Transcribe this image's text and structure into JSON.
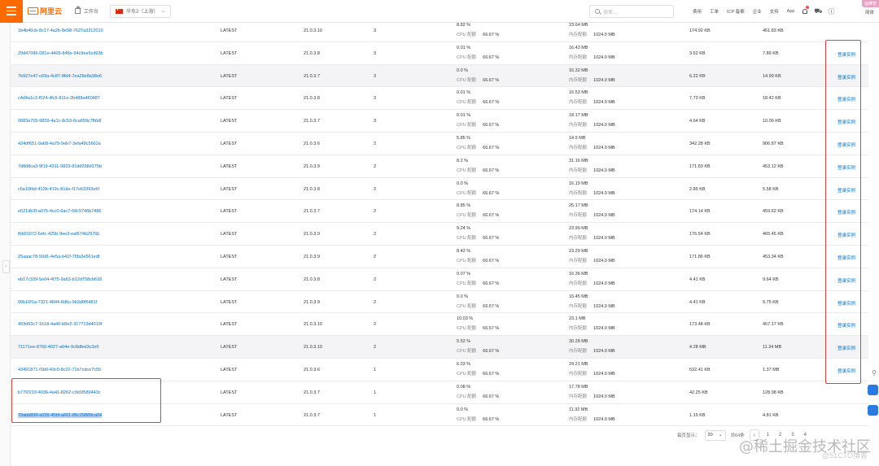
{
  "topbar": {
    "brand": "阿里云",
    "workbench": "工作台",
    "region": "华东2（上海）",
    "search_placeholder": "搜索...",
    "links": [
      "费用",
      "工单",
      "ICP 备案",
      "企业",
      "支持",
      "App"
    ],
    "lang": "简体",
    "user_tag": "运维管"
  },
  "rows": [
    {
      "id": "1b4b40cb-8c17-4a2b-8e98-7627a3312010",
      "tag": "LATEST",
      "version": "21.0.3.10",
      "count": "3",
      "cpu": "8.82 %",
      "cpu_label": "CPU 配额",
      "cpu_quota": "66.67 %",
      "mem": "23.64 MB",
      "mem_label": "内存配额",
      "mem_quota": "1024.0 MB",
      "net": "174.92 KB",
      "blk": "461.83 KB",
      "action": ""
    },
    {
      "id": "29d47086-081e-4409-848e-94c9ee9cd93b",
      "tag": "LATEST",
      "version": "21.0.3.8",
      "count": "3",
      "cpu": "0.01 %",
      "cpu_label": "CPU 配额",
      "cpu_quota": "66.67 %",
      "mem": "16.43 MB",
      "mem_label": "内存配额",
      "mem_quota": "1024.0 MB",
      "net": "3.62 KB",
      "blk": "7.89 KB",
      "action": "登录实例"
    },
    {
      "id": "7b927e47-c69a-4c87-8fd4-7ea28e8a98e6",
      "tag": "LATEST",
      "version": "21.0.3.7",
      "count": "3",
      "cpu": "0.0 %",
      "cpu_label": "CPU 配额",
      "cpu_quota": "66.67 %",
      "mem": "16.32 MB",
      "mem_label": "内存配额",
      "mem_quota": "1024.0 MB",
      "net": "6.22 KB",
      "blk": "14.99 KB",
      "action": "登录实例"
    },
    {
      "id": "c4d4a1c3-f524-4fc5-811e-2b488a460487",
      "tag": "LATEST",
      "version": "21.0.3.8",
      "count": "3",
      "cpu": "0.01 %",
      "cpu_label": "CPU 配额",
      "cpu_quota": "66.67 %",
      "mem": "16.53 MB",
      "mem_label": "内存配额",
      "mem_quota": "1024.0 MB",
      "net": "7.73 KB",
      "blk": "18.42 KB",
      "action": "登录实例"
    },
    {
      "id": "0883e705-9839-4a1c-8c53-0ca659c7fbb8",
      "tag": "LATEST",
      "version": "21.0.3.7",
      "count": "3",
      "cpu": "0.01 %",
      "cpu_label": "CPU 配额",
      "cpu_quota": "66.67 %",
      "mem": "18.17 MB",
      "mem_label": "内存配额",
      "mem_quota": "1024.0 MB",
      "net": "4.64 KB",
      "blk": "10.06 KB",
      "action": "登录实例"
    },
    {
      "id": "424df651-9a68-4a79-9eb7-3efa48c5662a",
      "tag": "LATEST",
      "version": "21.0.3.6",
      "count": "2",
      "cpu": "5.85 %",
      "cpu_label": "CPU 配额",
      "cpu_quota": "66.67 %",
      "mem": "14.9 MB",
      "mem_label": "内存配额",
      "mem_quota": "1024.0 MB",
      "net": "342.28 KB",
      "blk": "906.87 KB",
      "action": "登录实例"
    },
    {
      "id": "7d8d8ca3-9f19-4311-9833-81dd298d175b",
      "tag": "LATEST",
      "version": "21.0.3.9",
      "count": "2",
      "cpu": "8.2 %",
      "cpu_label": "CPU 配额",
      "cpu_quota": "66.67 %",
      "mem": "31.16 MB",
      "mem_label": "内存配额",
      "mem_quota": "1024.0 MB",
      "net": "171.83 KB",
      "blk": "453.12 KB",
      "action": "登录实例"
    },
    {
      "id": "c6a10fdd-412b-419c-81de-f17e63393e6f",
      "tag": "LATEST",
      "version": "21.0.3.8",
      "count": "2",
      "cpu": "0.0 %",
      "cpu_label": "CPU 配额",
      "cpu_quota": "66.67 %",
      "mem": "16.19 MB",
      "mem_label": "内存配额",
      "mem_quota": "1024.0 MB",
      "net": "2.85 KB",
      "blk": "5.58 KB",
      "action": "登录实例"
    },
    {
      "id": "e621db3f-a075-4cc0-9ac7-68c9746b7486",
      "tag": "LATEST",
      "version": "21.0.3.7",
      "count": "2",
      "cpu": "8.85 %",
      "cpu_label": "CPU 配额",
      "cpu_quota": "66.67 %",
      "mem": "25.17 MB",
      "mem_label": "内存配额",
      "mem_quota": "1024.0 MB",
      "net": "174.14 KB",
      "blk": "459.62 KB",
      "action": "登录实例"
    },
    {
      "id": "fbb91072-6efc-425b-9ee3-eaf674b2976b",
      "tag": "LATEST",
      "version": "21.0.3.9",
      "count": "2",
      "cpu": "9.24 %",
      "cpu_label": "CPU 配额",
      "cpu_quota": "66.67 %",
      "mem": "23.99 MB",
      "mem_label": "内存配额",
      "mem_quota": "1024.0 MB",
      "net": "176.54 KB",
      "blk": "465.45 KB",
      "action": "登录实例"
    },
    {
      "id": "25aaac78-50d1-4e5a-b41f-7f3a3e561edf",
      "tag": "LATEST",
      "version": "21.0.3.9",
      "count": "2",
      "cpu": "8.42 %",
      "cpu_label": "CPU 配额",
      "cpu_quota": "66.67 %",
      "mem": "23.29 MB",
      "mem_label": "内存配额",
      "mem_quota": "1024.0 MB",
      "net": "171.86 KB",
      "blk": "453.34 KB",
      "action": "登录实例"
    },
    {
      "id": "eb17c339-5e64-4f75-9a63-b12d758cb618",
      "tag": "LATEST",
      "version": "21.0.3.8",
      "count": "2",
      "cpu": "0.07 %",
      "cpu_label": "CPU 配额",
      "cpu_quota": "66.67 %",
      "mem": "16.36 MB",
      "mem_label": "内存配额",
      "mem_quota": "1024.0 MB",
      "net": "4.41 KB",
      "blk": "9.64 KB",
      "action": "登录实例"
    },
    {
      "id": "90b10f1a-7321-4844-8d6c-9b3d0f6481f",
      "tag": "LATEST",
      "version": "21.0.3.9",
      "count": "2",
      "cpu": "0.0 %",
      "cpu_label": "CPU 配额",
      "cpu_quota": "66.67 %",
      "mem": "16.45 MB",
      "mem_label": "内存配额",
      "mem_quota": "1024.0 MB",
      "net": "4.41 KB",
      "blk": "9.75 KB",
      "action": "登录实例"
    },
    {
      "id": "403d93c7-1618-4a40-b8e2-317719d4010f",
      "tag": "LATEST",
      "version": "21.0.3.10",
      "count": "2",
      "cpu": "10.03 %",
      "cpu_label": "CPU 配额",
      "cpu_quota": "66.67 %",
      "mem": "23.1 MB",
      "mem_label": "内存配额",
      "mem_quota": "1024.0 MB",
      "net": "173.48 KB",
      "blk": "457.17 KB",
      "action": "登录实例"
    },
    {
      "id": "71171ee-8760-4027-a04e-9c8dfed3c3e5",
      "tag": "LATEST",
      "version": "21.0.3.10",
      "count": "2",
      "cpu": "5.52 %",
      "cpu_label": "CPU 配额",
      "cpu_quota": "66.67 %",
      "mem": "30.28 MB",
      "mem_label": "内存配额",
      "mem_quota": "1024.0 MB",
      "net": "4.28 MB",
      "blk": "11.34 MB",
      "action": "登录实例"
    },
    {
      "id": "43491871-f1b0-43c0-8c22-71b7cdce7c55",
      "tag": "LATEST",
      "version": "21.0.3.6",
      "count": "1",
      "cpu": "6.03 %",
      "cpu_label": "CPU 配额",
      "cpu_quota": "66.67 %",
      "mem": "24.21 MB",
      "mem_label": "内存配额",
      "mem_quota": "1024.0 MB",
      "net": "532.41 KB",
      "blk": "1.37 MB",
      "action": "登录实例"
    },
    {
      "id": "b776f219-4036-4a41-8262-c9d1f589443c",
      "tag": "LATEST",
      "version": "21.0.3.7",
      "count": "1",
      "cpu": "0.08 %",
      "cpu_label": "CPU 配额",
      "cpu_quota": "66.67 %",
      "mem": "17.78 MB",
      "mem_label": "内存配额",
      "mem_quota": "1024.0 MB",
      "net": "42.25 KB",
      "blk": "128.98 KB",
      "action": ""
    },
    {
      "id": "79abb899-a036-45bf-a601-86c29889ca04",
      "tag": "LATEST",
      "version": "21.0.3.7",
      "count": "1",
      "cpu": "0.0 %",
      "cpu_label": "CPU 配额",
      "cpu_quota": "66.67 %",
      "mem": "11.32 MB",
      "mem_label": "内存配额",
      "mem_quota": "1024.0 MB",
      "net": "1.19 KB",
      "blk": "4.81 KB",
      "action": ""
    }
  ],
  "pagination": {
    "per_page_label": "每页显示：",
    "per_page_value": "20",
    "total": "共64条",
    "pages": [
      "1",
      "2",
      "3",
      "4"
    ],
    "current_page": "1"
  },
  "watermark": {
    "text": "@稀土掘金技术社区",
    "sub": "@51CTO博客"
  },
  "colors": {
    "accent": "#ff6a00",
    "link": "#0070cc",
    "highlight_box": "#e0403a"
  }
}
